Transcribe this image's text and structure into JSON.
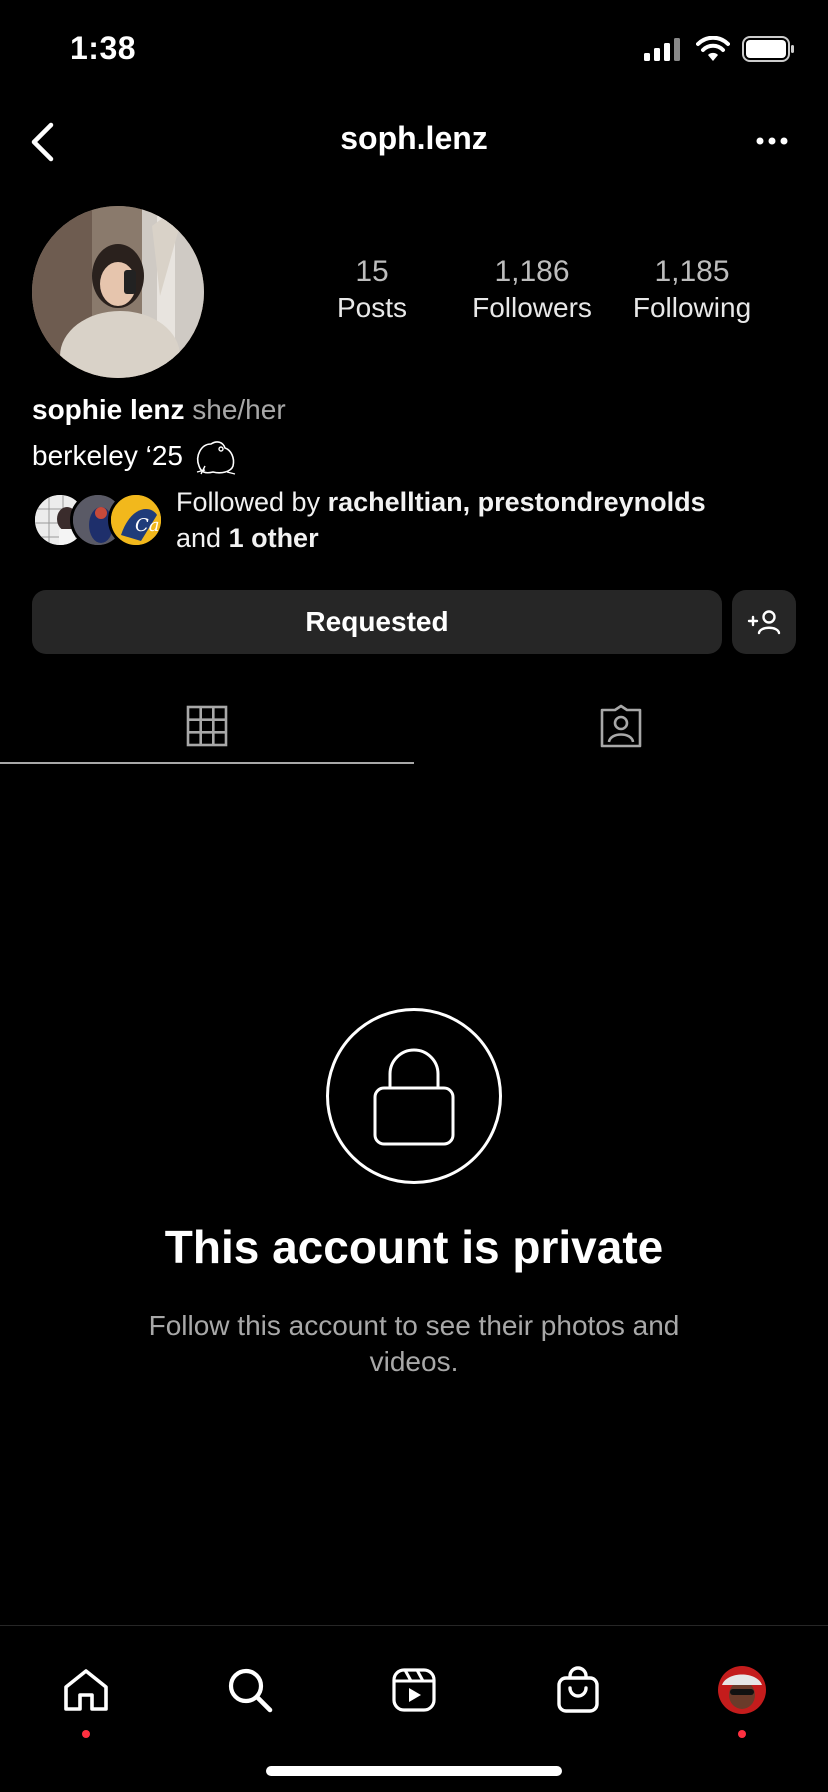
{
  "status_bar": {
    "time": "1:38"
  },
  "header": {
    "username": "soph.lenz"
  },
  "profile": {
    "stats": [
      {
        "value": "15",
        "label": "Posts"
      },
      {
        "value": "1,186",
        "label": "Followers"
      },
      {
        "value": "1,185",
        "label": "Following"
      }
    ],
    "name": "sophie lenz",
    "pronouns": "she/her",
    "bio": "berkeley ‘25",
    "followed_by": {
      "prefix": "Followed by ",
      "names": "rachelltian, prestondreynolds",
      "and": "and ",
      "others": "1 other"
    }
  },
  "actions": {
    "requested_label": "Requested"
  },
  "tabs": [
    {
      "icon": "grid-icon"
    },
    {
      "icon": "tagged-icon"
    }
  ],
  "private": {
    "title": "This account is private",
    "subtitle": "Follow this account to see their photos and videos."
  },
  "bottom_nav": [
    "home-icon",
    "search-icon",
    "reels-icon",
    "shop-icon",
    "profile-avatar"
  ],
  "colors": {
    "background": "#000000",
    "button": "#262626",
    "muted": "#a8a8a8",
    "notification_dot": "#ff3040"
  }
}
